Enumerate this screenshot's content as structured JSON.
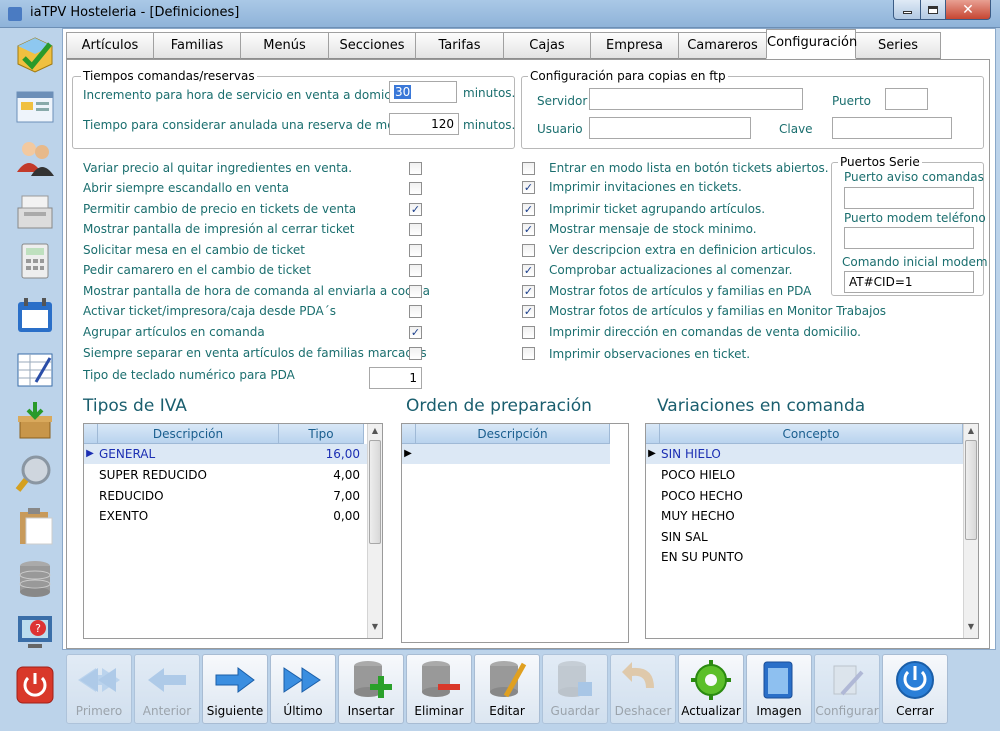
{
  "window": {
    "title": "iaTPV Hosteleria - [Definiciones]"
  },
  "tabs": [
    "Artículos",
    "Familias",
    "Menús",
    "Secciones",
    "Tarifas",
    "Cajas",
    "Empresa",
    "Camareros",
    "Configuración",
    "Series"
  ],
  "active_tab": "Configuración",
  "tiempos": {
    "title": "Tiempos comandas/reservas",
    "incremento_label": "Incremento para hora de servicio en venta a domicilio",
    "incremento_value": "30",
    "incremento_unit": "minutos.",
    "anulada_label": "Tiempo para considerar anulada una reserva de mesa",
    "anulada_value": "120",
    "anulada_unit": "minutos."
  },
  "ftp": {
    "title": "Configuración para copias en ftp",
    "servidor_label": "Servidor",
    "puerto_label": "Puerto",
    "usuario_label": "Usuario",
    "clave_label": "Clave",
    "servidor_value": "",
    "puerto_value": "",
    "usuario_value": "",
    "clave_value": ""
  },
  "options_left": [
    {
      "label": "Variar precio al quitar ingredientes en venta.",
      "checked": false
    },
    {
      "label": "Abrir siempre escandallo en venta",
      "checked": false
    },
    {
      "label": "Permitir cambio de precio en tickets de venta",
      "checked": true
    },
    {
      "label": "Mostrar pantalla de impresión al cerrar ticket",
      "checked": false
    },
    {
      "label": "Solicitar mesa en el cambio de ticket",
      "checked": false
    },
    {
      "label": "Pedir camarero en el cambio de ticket",
      "checked": false
    },
    {
      "label": "Mostrar pantalla de hora de comanda al enviarla a cocina",
      "checked": false
    },
    {
      "label": "Activar ticket/impresora/caja desde PDA´s",
      "checked": false
    },
    {
      "label": "Agrupar artículos en comanda",
      "checked": true
    },
    {
      "label": "Siempre separar en venta artículos de familias marcadas",
      "checked": false
    }
  ],
  "teclado": {
    "label": "Tipo de teclado numérico para PDA",
    "value": "1"
  },
  "options_right": [
    {
      "label": "Entrar en modo lista en botón tickets abiertos.",
      "checked": false
    },
    {
      "label": "Imprimir invitaciones en tickets.",
      "checked": true
    },
    {
      "label": "Imprimir ticket agrupando artículos.",
      "checked": true
    },
    {
      "label": "Mostrar mensaje de stock minimo.",
      "checked": true
    },
    {
      "label": "Ver descripcion extra en definicion articulos.",
      "checked": false
    },
    {
      "label": "Comprobar actualizaciones al comenzar.",
      "checked": true
    },
    {
      "label": "Mostrar fotos de artículos y familias en PDA",
      "checked": true
    },
    {
      "label": "Mostrar fotos de artículos y familias en Monitor Trabajos",
      "checked": true
    },
    {
      "label": "Imprimir dirección en comandas de venta domicilio.",
      "checked": false
    },
    {
      "label": "Imprimir observaciones en ticket.",
      "checked": false
    }
  ],
  "puertos": {
    "title": "Puertos Serie",
    "aviso_label": "Puerto aviso comandas",
    "aviso_value": "",
    "modem_label": "Puerto modem teléfono",
    "modem_value": "",
    "comando_label": "Comando inicial modem",
    "comando_value": "AT#CID=1"
  },
  "iva": {
    "title": "Tipos de IVA",
    "headers": [
      "Descripción",
      "Tipo"
    ],
    "rows": [
      {
        "desc": "GENERAL",
        "tipo": "16,00"
      },
      {
        "desc": "SUPER REDUCIDO",
        "tipo": "4,00"
      },
      {
        "desc": "REDUCIDO",
        "tipo": "7,00"
      },
      {
        "desc": "EXENTO",
        "tipo": "0,00"
      }
    ]
  },
  "preparacion": {
    "title": "Orden de preparación",
    "headers": [
      "Descripción"
    ]
  },
  "variaciones": {
    "title": "Variaciones en comanda",
    "headers": [
      "Concepto"
    ],
    "rows": [
      "SIN HIELO",
      "POCO HIELO",
      "POCO HECHO",
      "MUY HECHO",
      "SIN SAL",
      "EN SU PUNTO"
    ]
  },
  "toolbar": [
    {
      "label": "Primero",
      "icon": "double-left-arrow-icon",
      "enabled": false
    },
    {
      "label": "Anterior",
      "icon": "left-arrow-icon",
      "enabled": false
    },
    {
      "label": "Siguiente",
      "icon": "right-arrow-icon",
      "enabled": true
    },
    {
      "label": "Último",
      "icon": "double-right-arrow-icon",
      "enabled": true
    },
    {
      "label": "Insertar",
      "icon": "database-add-icon",
      "enabled": true
    },
    {
      "label": "Eliminar",
      "icon": "database-remove-icon",
      "enabled": true
    },
    {
      "label": "Editar",
      "icon": "database-edit-icon",
      "enabled": true
    },
    {
      "label": "Guardar",
      "icon": "database-save-icon",
      "enabled": false
    },
    {
      "label": "Deshacer",
      "icon": "undo-icon",
      "enabled": false
    },
    {
      "label": "Actualizar",
      "icon": "refresh-gear-icon",
      "enabled": true
    },
    {
      "label": "Imagen",
      "icon": "image-icon",
      "enabled": true
    },
    {
      "label": "Configurar",
      "icon": "configure-icon",
      "enabled": false
    },
    {
      "label": "Cerrar",
      "icon": "power-icon",
      "enabled": true
    }
  ],
  "colors": {
    "accent": "#1a6e6e",
    "selection": "#1c2fb3",
    "titlebar": "#8fb3d9"
  }
}
